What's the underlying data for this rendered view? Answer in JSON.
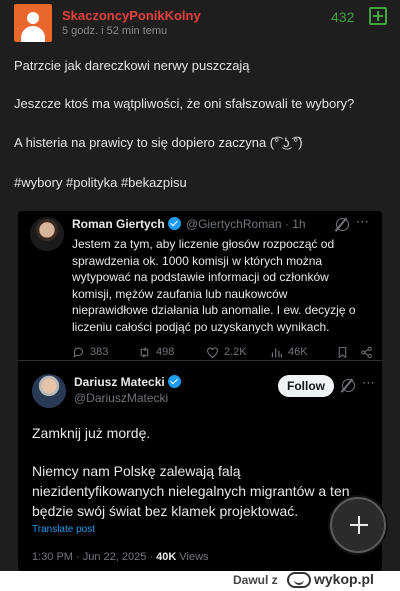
{
  "post": {
    "username": "SkaczoncyPonikKolny",
    "timestamp": "5 godz. i 52 min temu",
    "votes": "432",
    "lines": [
      "Patrzcie jak dareczkowi nerwy puszczają",
      "Jeszcze ktoś ma wątpliwości, że oni sfałszowali te wybory?",
      "A histeria na prawicy to się dopiero zaczyna (͡° ͜ʖ ͡°)",
      "#wybory #polityka #bekazpisu"
    ]
  },
  "embed": {
    "tweet1": {
      "name": "Roman Giertych",
      "handle": "@GiertychRoman · 1h",
      "body_lines": [
        "Jestem za tym, aby liczenie głosów rozpocząć od",
        "sprawdzenia ok. 1000 komisji w których można",
        "wytypować na podstawie informacji od członków",
        "komisji, mężów zaufania lub naukowców",
        "nieprawidłowe działania lub anomalie. I ew. decyzję o",
        "liczeniu całości podjąć po uzyskanych wynikach."
      ],
      "replies": "383",
      "reposts": "498",
      "likes": "2.2K",
      "views": "46K"
    },
    "tweet2": {
      "name": "Dariusz Matecki",
      "handle": "@DariuszMatecki",
      "follow_label": "Follow",
      "line1": "Zamknij już mordę.",
      "lines": [
        "Niemcy nam Polskę zalewają falą",
        "niezidentyfikowanych nielegalnych migrantów a ten",
        "będzie swój świat bez klamek projektować."
      ],
      "translate": "Translate post",
      "date": "1:30 PM · Jun 22, 2025 · ",
      "views_count": "40K",
      "views_label": " Views"
    }
  },
  "footer": {
    "user": "Dawul z",
    "site": "wykop.pl"
  },
  "colors": {
    "username": "#e3433e",
    "votes": "#3fa33f",
    "avatar_bg": "#e9672c",
    "twitter_blue": "#1d9bf0"
  },
  "icons": [
    "user-avatar-icon",
    "plus-icon",
    "verified-icon",
    "grok-icon",
    "more-icon",
    "reply-icon",
    "repost-icon",
    "like-icon",
    "views-icon",
    "bookmark-icon",
    "share-icon",
    "add-fab-icon",
    "wykop-logo-icon"
  ]
}
